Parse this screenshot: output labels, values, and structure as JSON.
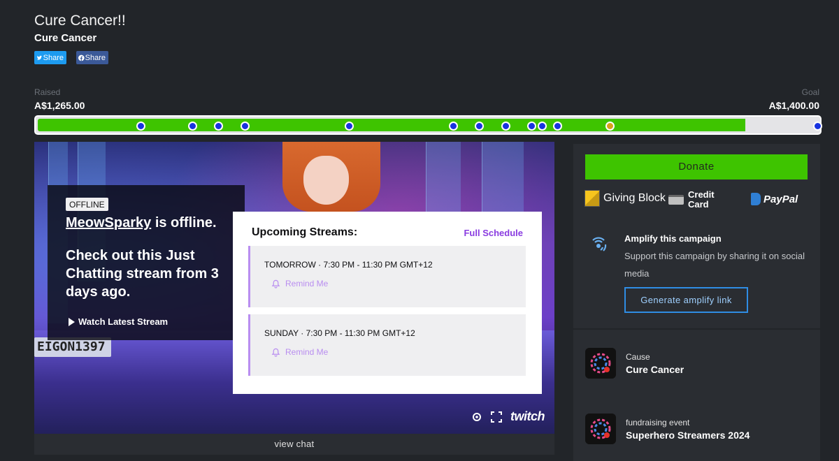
{
  "campaign": {
    "title": "Cure Cancer!!",
    "cause_name": "Cure Cancer",
    "share_twitter": "Share",
    "share_facebook": "Share"
  },
  "progress": {
    "raised_label": "Raised",
    "raised_value": "A$1,265.00",
    "goal_label": "Goal",
    "goal_value": "A$1,400.00",
    "fraction": 0.9036,
    "milestones": [
      {
        "fraction": 0.0714,
        "color": "#1833e0"
      },
      {
        "fraction": 0.1429,
        "color": "#1833e0"
      },
      {
        "fraction": 0.1786,
        "color": "#1833e0"
      },
      {
        "fraction": 0.2143,
        "color": "#1833e0"
      },
      {
        "fraction": 0.3571,
        "color": "#1833e0"
      },
      {
        "fraction": 0.5,
        "color": "#1833e0"
      },
      {
        "fraction": 0.5357,
        "color": "#1833e0"
      },
      {
        "fraction": 0.5714,
        "color": "#1833e0"
      },
      {
        "fraction": 0.6071,
        "color": "#1833e0"
      },
      {
        "fraction": 0.6214,
        "color": "#1833e0"
      },
      {
        "fraction": 0.6429,
        "color": "#1833e0"
      },
      {
        "fraction": 0.7143,
        "color": "#d6a219"
      },
      {
        "fraction": 1.0,
        "color": "#1833e0"
      }
    ]
  },
  "stream": {
    "status_badge": "OFFLINE",
    "channel": "MeowSparky",
    "offline_suffix": " is offline.",
    "message": "Check out this Just Chatting stream from 3 days ago.",
    "watch_latest": "Watch Latest Stream",
    "plate_text": "EIGON1397",
    "upcoming_title": "Upcoming Streams:",
    "full_schedule": "Full Schedule",
    "schedule": [
      {
        "day": "TOMORROW",
        "time": "7:30 PM - 11:30 PM GMT+12",
        "remind": "Remind Me"
      },
      {
        "day": "SUNDAY",
        "time": "7:30 PM - 11:30 PM GMT+12",
        "remind": "Remind Me"
      }
    ],
    "player_brand": "twitch",
    "view_chat": "view chat"
  },
  "sidebar": {
    "donate_label": "Donate",
    "giving_block": "Giving Block",
    "credit_card": "Credit Card",
    "paypal": "PayPal",
    "amplify_title": "Amplify this campaign",
    "amplify_desc": "Support this campaign by sharing it on social media",
    "amplify_button": "Generate amplify link",
    "cause_label": "Cause",
    "cause_value": "Cure Cancer",
    "event_label": "fundraising event",
    "event_value": "Superhero Streamers 2024"
  },
  "colors": {
    "background": "#222529",
    "panel": "#2a2d32",
    "progress_green": "#3ec400",
    "twitch_purple": "#8a3ce0"
  }
}
